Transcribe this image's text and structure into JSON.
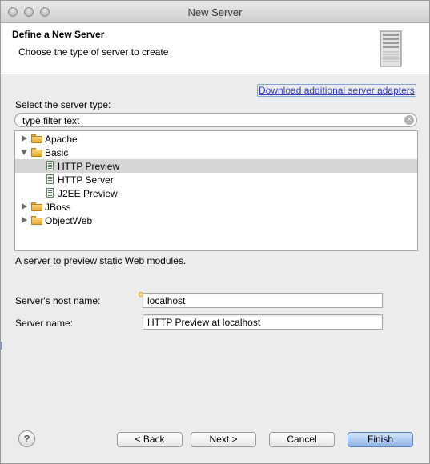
{
  "window": {
    "title": "New Server"
  },
  "banner": {
    "title": "Define a New Server",
    "description": "Choose the type of server to create"
  },
  "download_link": "Download additional server adapters",
  "select_label": "Select the server type:",
  "filter": {
    "value": "type filter text"
  },
  "tree": {
    "apache": "Apache",
    "basic": "Basic",
    "http_preview": "HTTP Preview",
    "http_server": "HTTP Server",
    "j2ee_preview": "J2EE Preview",
    "jboss": "JBoss",
    "objectweb": "ObjectWeb"
  },
  "description": "A server to preview static Web modules.",
  "form": {
    "host_label": "Server's host name:",
    "host_value": "localhost",
    "name_label": "Server name:",
    "name_value": "HTTP Preview at localhost"
  },
  "buttons": {
    "back": "< Back",
    "next": "Next >",
    "cancel": "Cancel",
    "finish": "Finish"
  },
  "icons": {
    "help": "?",
    "clear": "×"
  }
}
